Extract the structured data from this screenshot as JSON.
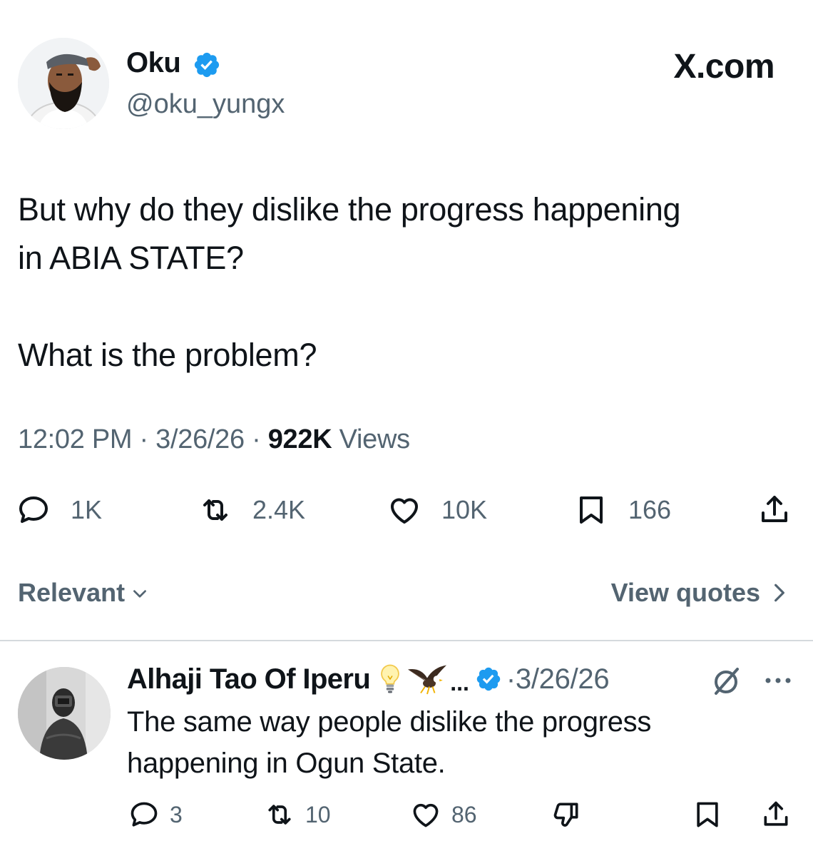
{
  "header": {
    "display_name": "Oku",
    "handle": "@oku_yungx",
    "brand": "X.com",
    "verified_color": "#1d9bf0"
  },
  "tweet": {
    "line1": "But why do they dislike the progress happening",
    "line2": "in ABIA STATE?",
    "line3": "What is the problem?",
    "time": "12:02 PM",
    "date": "3/26/26",
    "views_count": "922K",
    "views_label": "Views"
  },
  "actions": {
    "replies": "1K",
    "reposts": "2.4K",
    "likes": "10K",
    "bookmarks": "166"
  },
  "sort": {
    "label": "Relevant",
    "view_quotes": "View quotes"
  },
  "reply": {
    "display_name": "Alhaji Tao Of Iperu",
    "ellipsis": "...",
    "separator": "·",
    "date": "3/26/26",
    "line1": "The same way people dislike the progress",
    "line2": "happening in Ogun State.",
    "replies": "3",
    "reposts": "10",
    "likes": "86"
  },
  "icons": {
    "reply": "speech-bubble-icon",
    "repost": "repost-arrows-icon",
    "like": "heart-icon",
    "bookmark": "bookmark-icon",
    "share": "share-upload-icon",
    "dislike": "thumbs-down-icon",
    "grok": "grok-slash-circle-icon",
    "more": "more-dots-icon"
  }
}
